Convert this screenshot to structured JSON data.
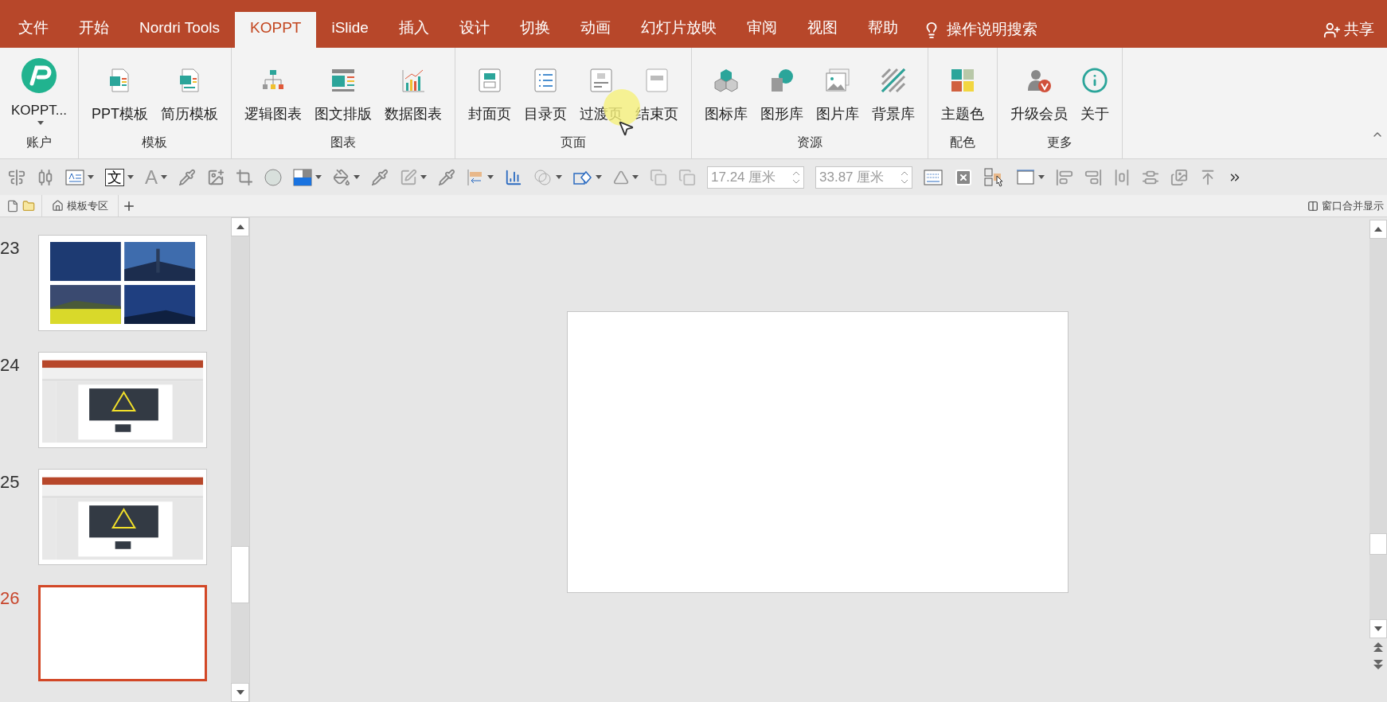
{
  "ribbon_tabs": [
    {
      "label": "文件",
      "selected": false
    },
    {
      "label": "开始",
      "selected": false
    },
    {
      "label": "Nordri Tools",
      "selected": false
    },
    {
      "label": "KOPPT",
      "selected": true
    },
    {
      "label": "iSlide",
      "selected": false
    },
    {
      "label": "插入",
      "selected": false
    },
    {
      "label": "设计",
      "selected": false
    },
    {
      "label": "切换",
      "selected": false
    },
    {
      "label": "动画",
      "selected": false
    },
    {
      "label": "幻灯片放映",
      "selected": false
    },
    {
      "label": "审阅",
      "selected": false
    },
    {
      "label": "视图",
      "selected": false
    },
    {
      "label": "帮助",
      "selected": false
    }
  ],
  "tell_me": "操作说明搜索",
  "share": "共享",
  "ribbon_groups": [
    {
      "label": "账户",
      "buttons": [
        "KOPPT..."
      ]
    },
    {
      "label": "模板",
      "buttons": [
        "PPT模板",
        "简历模板"
      ]
    },
    {
      "label": "图表",
      "buttons": [
        "逻辑图表",
        "图文排版",
        "数据图表"
      ]
    },
    {
      "label": "页面",
      "buttons": [
        "封面页",
        "目录页",
        "过渡页",
        "结束页"
      ]
    },
    {
      "label": "资源",
      "buttons": [
        "图标库",
        "图形库",
        "图片库",
        "背景库"
      ]
    },
    {
      "label": "配色",
      "buttons": [
        "主题色"
      ]
    },
    {
      "label": "更多",
      "buttons": [
        "升级会员",
        "关于"
      ]
    }
  ],
  "toolbar": {
    "text_glyph": "文",
    "font_glyph": "A",
    "width_value": "17.24 厘米",
    "height_value": "33.87 厘米"
  },
  "doc_tabs": [
    "模板专区"
  ],
  "merge_windows": "窗口合并显示",
  "slides": [
    {
      "number": "23",
      "selected": false,
      "kind": "photos"
    },
    {
      "number": "24",
      "selected": false,
      "kind": "screenshot"
    },
    {
      "number": "25",
      "selected": false,
      "kind": "screenshot"
    },
    {
      "number": "26",
      "selected": true,
      "kind": "blank"
    }
  ]
}
